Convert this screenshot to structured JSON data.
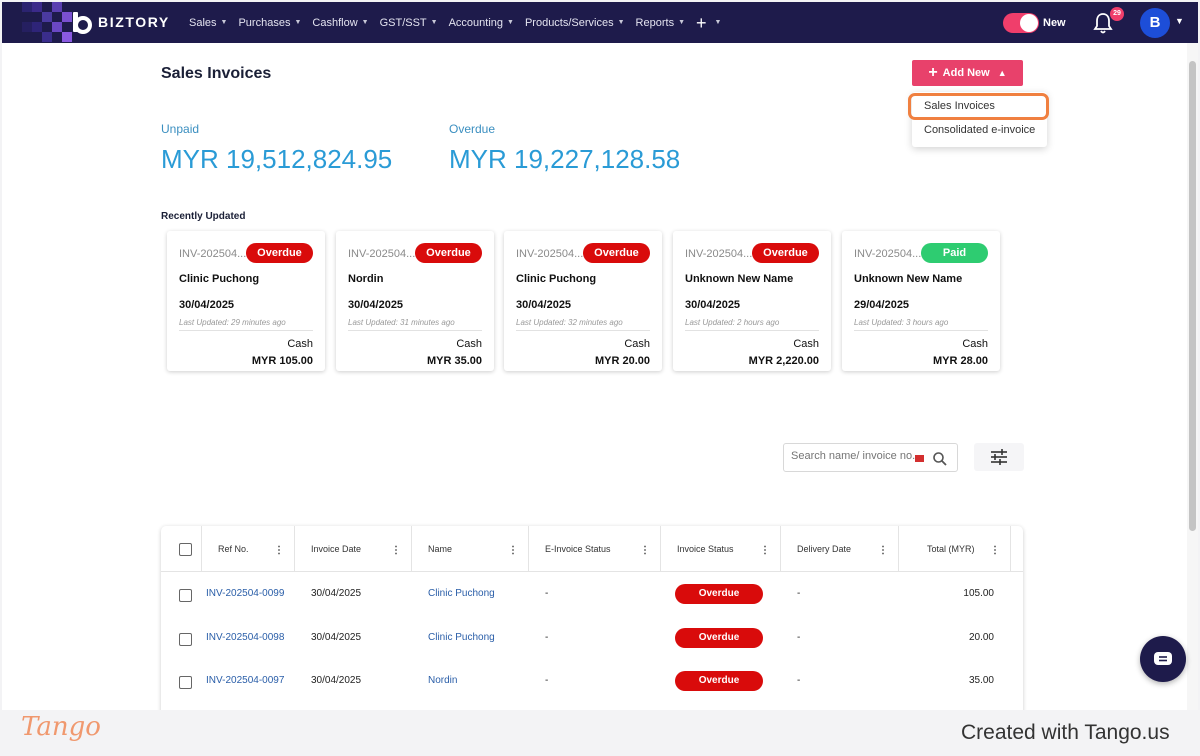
{
  "app": {
    "brand": "BIZTORY",
    "menu": [
      {
        "label": "Sales",
        "name": "nav-sales"
      },
      {
        "label": "Purchases",
        "name": "nav-purchases"
      },
      {
        "label": "Cashflow",
        "name": "nav-cashflow"
      },
      {
        "label": "GST/SST",
        "name": "nav-gst-sst"
      },
      {
        "label": "Accounting",
        "name": "nav-accounting"
      },
      {
        "label": "Products/Services",
        "name": "nav-products-services"
      },
      {
        "label": "Reports",
        "name": "nav-reports"
      }
    ],
    "toggle_label": "New",
    "notifications_count": "29",
    "avatar_initial": "B",
    "accent_color": "#e8416b",
    "nav_bg_color": "#1e1b4b"
  },
  "page": {
    "title": "Sales Invoices",
    "add_new_label": "Add New",
    "dropdown": [
      "Sales Invoices",
      "Consolidated e-invoice"
    ]
  },
  "stats": {
    "unpaid_label": "Unpaid",
    "unpaid_value": "MYR 19,512,824.95",
    "overdue_label": "Overdue",
    "overdue_value": "MYR 19,227,128.58"
  },
  "recent": {
    "title": "Recently Updated",
    "cards": [
      {
        "ref": "INV-202504...",
        "status": "Overdue",
        "status_color": "#d90b0b",
        "name": "Clinic Puchong",
        "date": "30/04/2025",
        "updated": "Last Updated: 29 minutes ago",
        "payment": "Cash",
        "amount": "MYR 105.00"
      },
      {
        "ref": "INV-202504...",
        "status": "Overdue",
        "status_color": "#d90b0b",
        "name": "Nordin",
        "date": "30/04/2025",
        "updated": "Last Updated: 31 minutes ago",
        "payment": "Cash",
        "amount": "MYR 35.00"
      },
      {
        "ref": "INV-202504...",
        "status": "Overdue",
        "status_color": "#d90b0b",
        "name": "Clinic Puchong",
        "date": "30/04/2025",
        "updated": "Last Updated: 32 minutes ago",
        "payment": "Cash",
        "amount": "MYR 20.00"
      },
      {
        "ref": "INV-202504...",
        "status": "Overdue",
        "status_color": "#d90b0b",
        "name": "Unknown New Name",
        "date": "30/04/2025",
        "updated": "Last Updated: 2 hours ago",
        "payment": "Cash",
        "amount": "MYR 2,220.00"
      },
      {
        "ref": "INV-202504...",
        "status": "Paid",
        "status_color": "#2ecc71",
        "name": "Unknown New Name",
        "date": "29/04/2025",
        "updated": "Last Updated: 3 hours ago",
        "payment": "Cash",
        "amount": "MYR 28.00"
      }
    ]
  },
  "search": {
    "placeholder": "Search name/ invoice no."
  },
  "table": {
    "columns": [
      "Ref No.",
      "Invoice Date",
      "Name",
      "E-Invoice Status",
      "Invoice Status",
      "Delivery Date",
      "Total (MYR)"
    ],
    "rows": [
      {
        "ref": "INV-202504-0099",
        "date": "30/04/2025",
        "name": "Clinic Puchong",
        "einvoice": "-",
        "status": "Overdue",
        "delivery": "-",
        "total": "105.00"
      },
      {
        "ref": "INV-202504-0098",
        "date": "30/04/2025",
        "name": "Clinic Puchong",
        "einvoice": "-",
        "status": "Overdue",
        "delivery": "-",
        "total": "20.00"
      },
      {
        "ref": "INV-202504-0097",
        "date": "30/04/2025",
        "name": "Nordin",
        "einvoice": "-",
        "status": "Overdue",
        "delivery": "-",
        "total": "35.00"
      }
    ]
  },
  "footer": {
    "logo": "Tango",
    "credit": "Created with Tango.us"
  }
}
